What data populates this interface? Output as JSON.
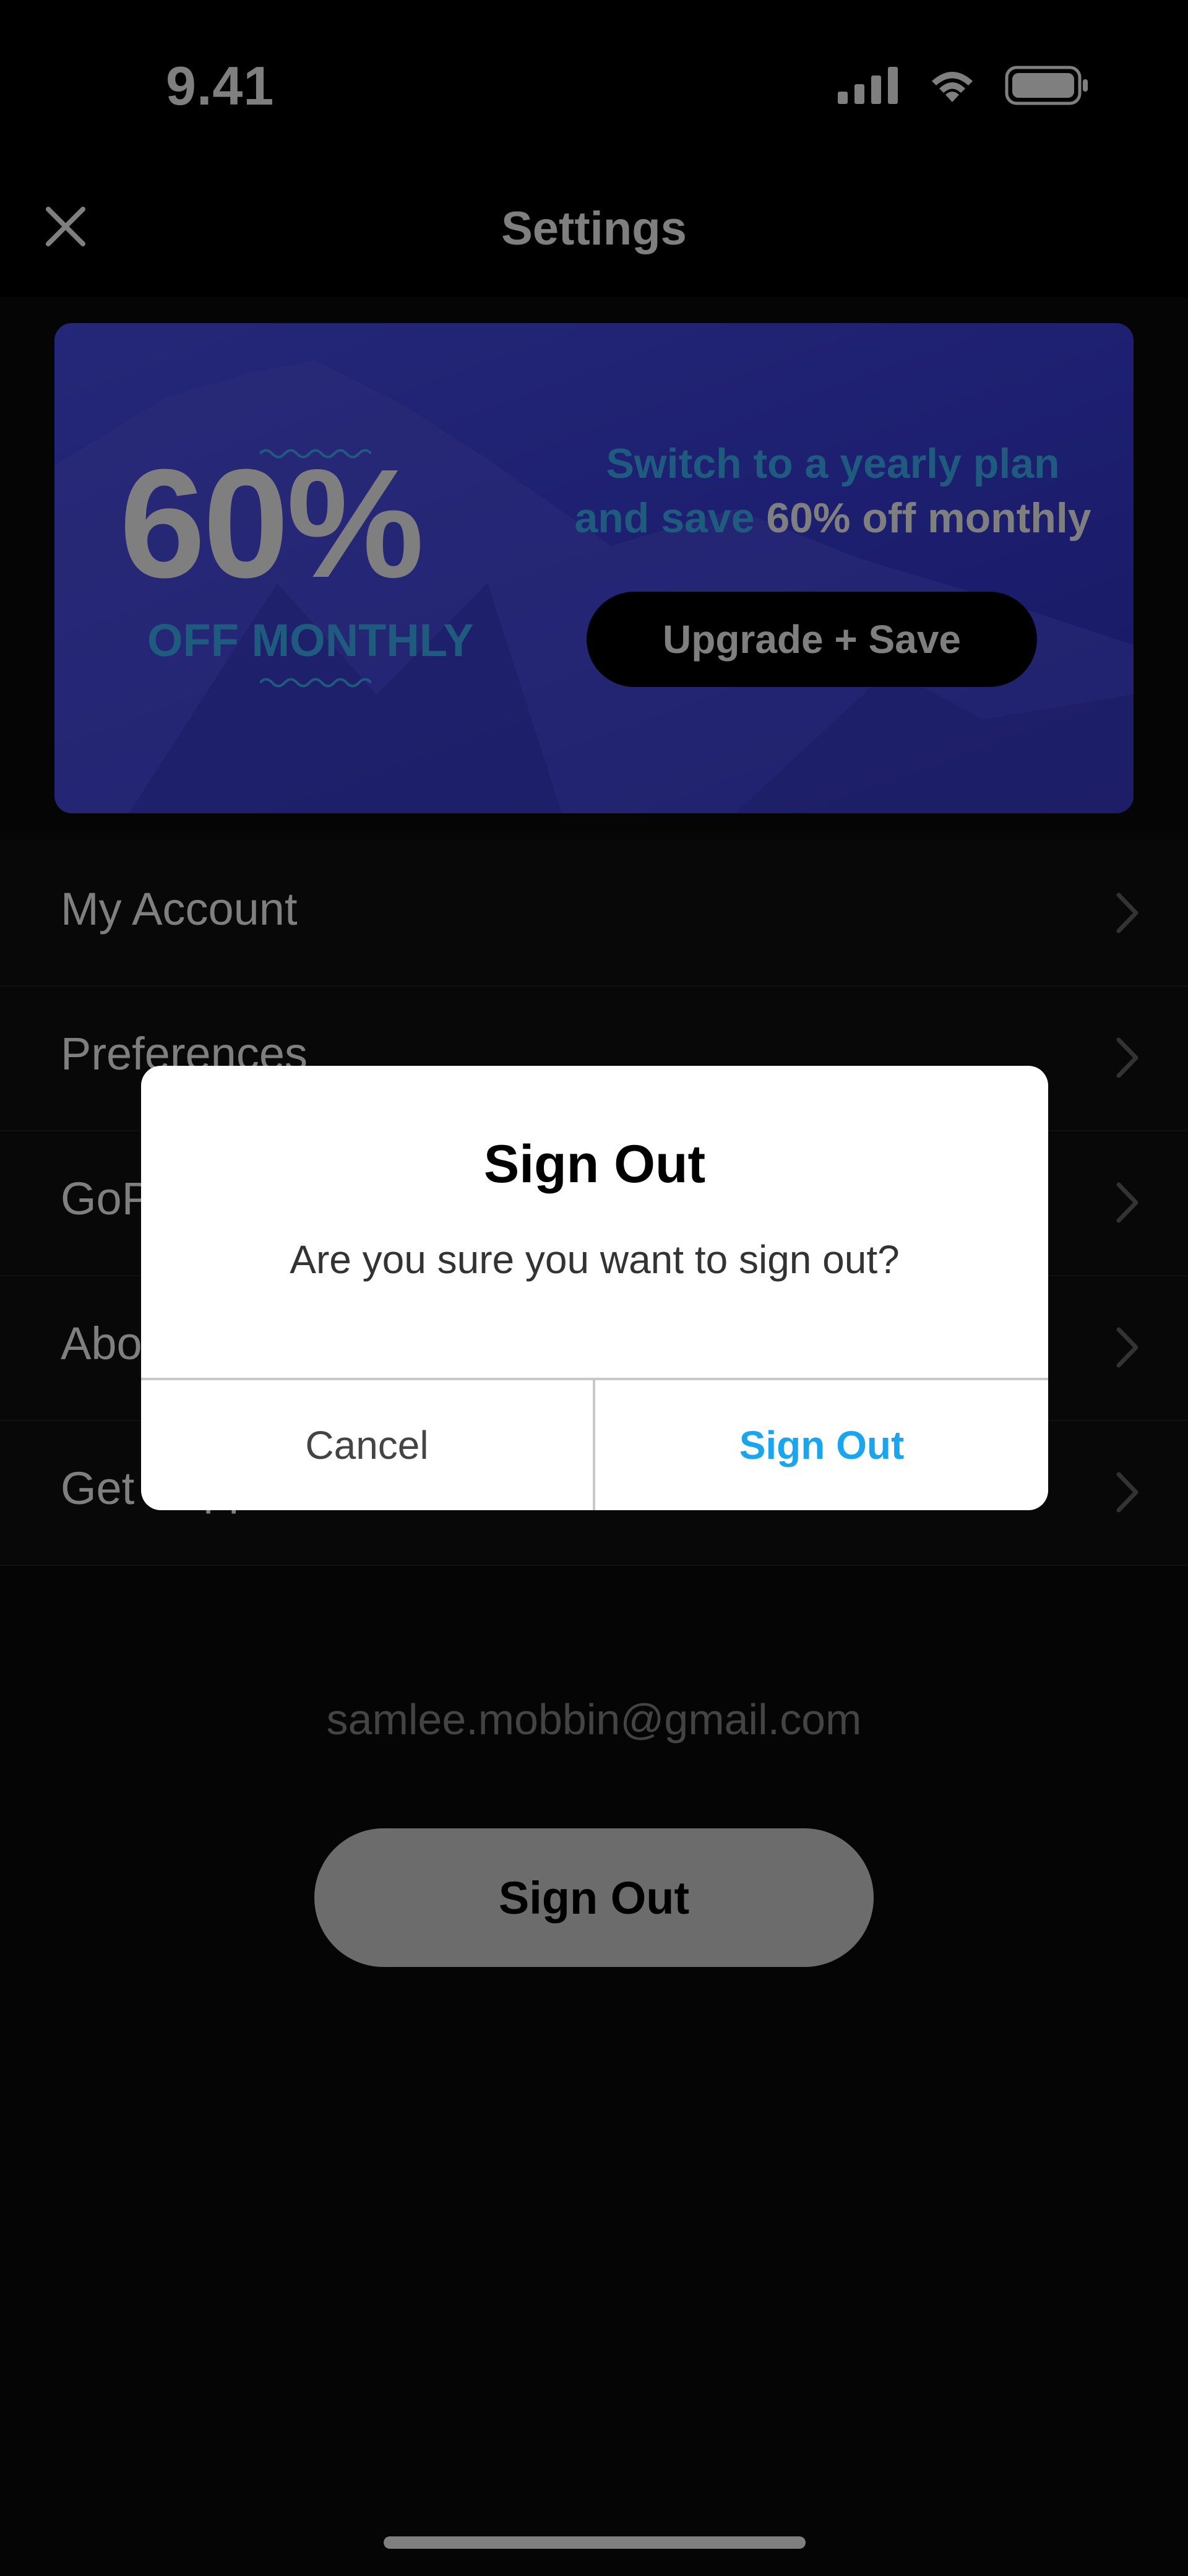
{
  "status_bar": {
    "time": "9.41",
    "icons": [
      "signal-icon",
      "wifi-icon",
      "battery-icon"
    ]
  },
  "header": {
    "title": "Settings",
    "close_icon": "close-icon"
  },
  "promo": {
    "big_text": "60%",
    "sub_text": "OFF MONTHLY",
    "line1": "Switch to a yearly plan",
    "line2_prefix": "and save ",
    "line2_highlight": "60% off monthly",
    "button_label": "Upgrade + Save"
  },
  "menu": {
    "items": [
      {
        "label": "My Account"
      },
      {
        "label": "Preferences"
      },
      {
        "label": "GoPro Subscription"
      },
      {
        "label": "About"
      },
      {
        "label": "Get Support"
      }
    ]
  },
  "account": {
    "email": "samlee.mobbin@gmail.com",
    "signout_label": "Sign Out"
  },
  "dialog": {
    "title": "Sign Out",
    "message": "Are you sure you want to sign out?",
    "cancel_label": "Cancel",
    "confirm_label": "Sign Out"
  },
  "colors": {
    "accent": "#1aa6ee",
    "promo_bg": "#3b3ee0",
    "promo_text": "#3fb4ff"
  }
}
